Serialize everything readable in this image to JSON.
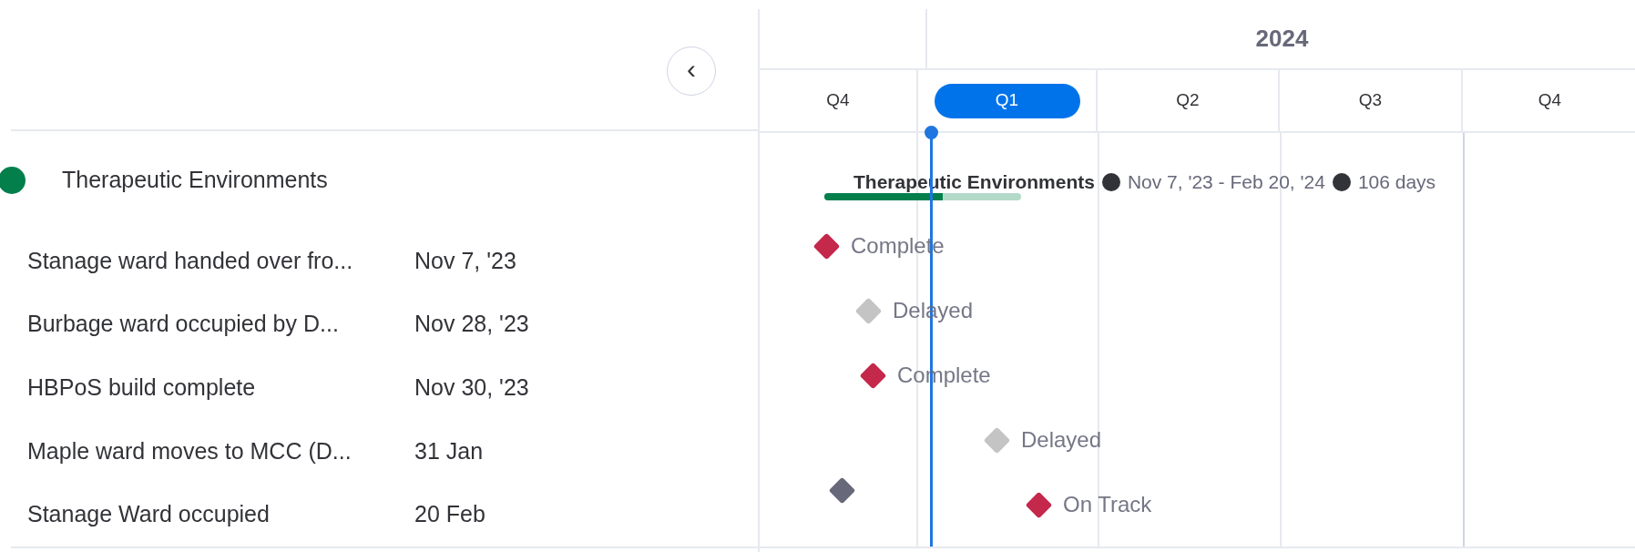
{
  "collapse_button": {
    "icon": "‹"
  },
  "timeline": {
    "year": "2024",
    "quarters": [
      {
        "label": "Q4",
        "selected": false
      },
      {
        "label": "Q1",
        "selected": true
      },
      {
        "label": "Q2",
        "selected": false
      },
      {
        "label": "Q3",
        "selected": false
      },
      {
        "label": "Q4",
        "selected": false
      }
    ]
  },
  "group": {
    "name": "Therapeutic Environments",
    "color": "#037f4c",
    "bar_label": "Therapeutic Environments",
    "range": "Nov 7, '23 - Feb 20, '24",
    "duration": "106 days",
    "level": 0.6
  },
  "items": [
    {
      "name": "Stanage ward handed over fro...",
      "date": "Nov 7, '23",
      "markers": [
        {
          "color": "#c4284a",
          "label": "Complete"
        }
      ]
    },
    {
      "name": "Burbage ward occupied by D...",
      "date": "Nov 28, '23",
      "markers": [
        {
          "color": "#c4c4c4",
          "label": "Delayed"
        }
      ]
    },
    {
      "name": "HBPoS build complete",
      "date": "Nov 30, '23",
      "markers": [
        {
          "color": "#c4284a",
          "label": "Complete"
        }
      ]
    },
    {
      "name": "Maple ward moves to MCC (D...",
      "date": "31 Jan",
      "markers": [
        {
          "color": "#c4c4c4",
          "label": "Delayed"
        }
      ]
    },
    {
      "name": "Stanage Ward occupied",
      "date": "20 Feb",
      "markers": [
        {
          "color": "#676879"
        },
        {
          "color": "#c4284a",
          "label": "On Track"
        }
      ]
    }
  ]
}
